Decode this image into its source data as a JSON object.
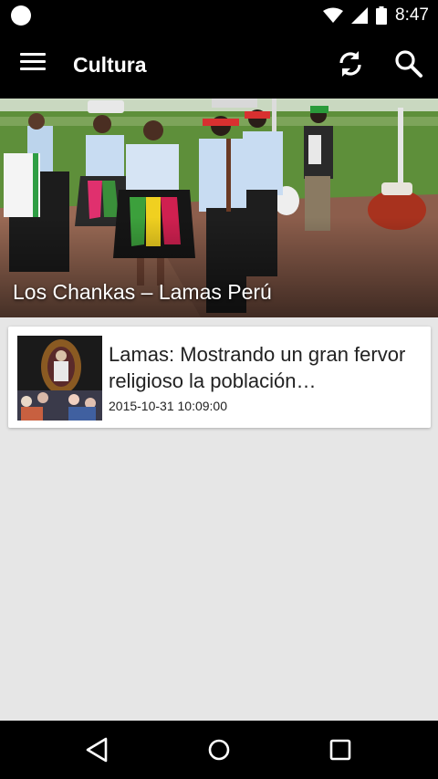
{
  "status_bar": {
    "time": "8:47",
    "icons": [
      "notification-dot-icon",
      "wifi-icon",
      "cell-signal-icon",
      "battery-icon"
    ]
  },
  "app_bar": {
    "title": "Cultura",
    "icons": [
      "menu-icon",
      "refresh-icon",
      "search-icon"
    ]
  },
  "hero": {
    "caption": "Los Chankas – Lamas Perú"
  },
  "articles": [
    {
      "title": "Lamas: Mostrando un gran fervor religioso la población…",
      "date": "2015-10-31 10:09:00"
    }
  ],
  "nav_bar": {
    "icons": [
      "back-icon",
      "home-icon",
      "recents-icon"
    ]
  },
  "colors": {
    "bars": "#000000",
    "background": "#e6e6e6",
    "card": "#ffffff"
  }
}
